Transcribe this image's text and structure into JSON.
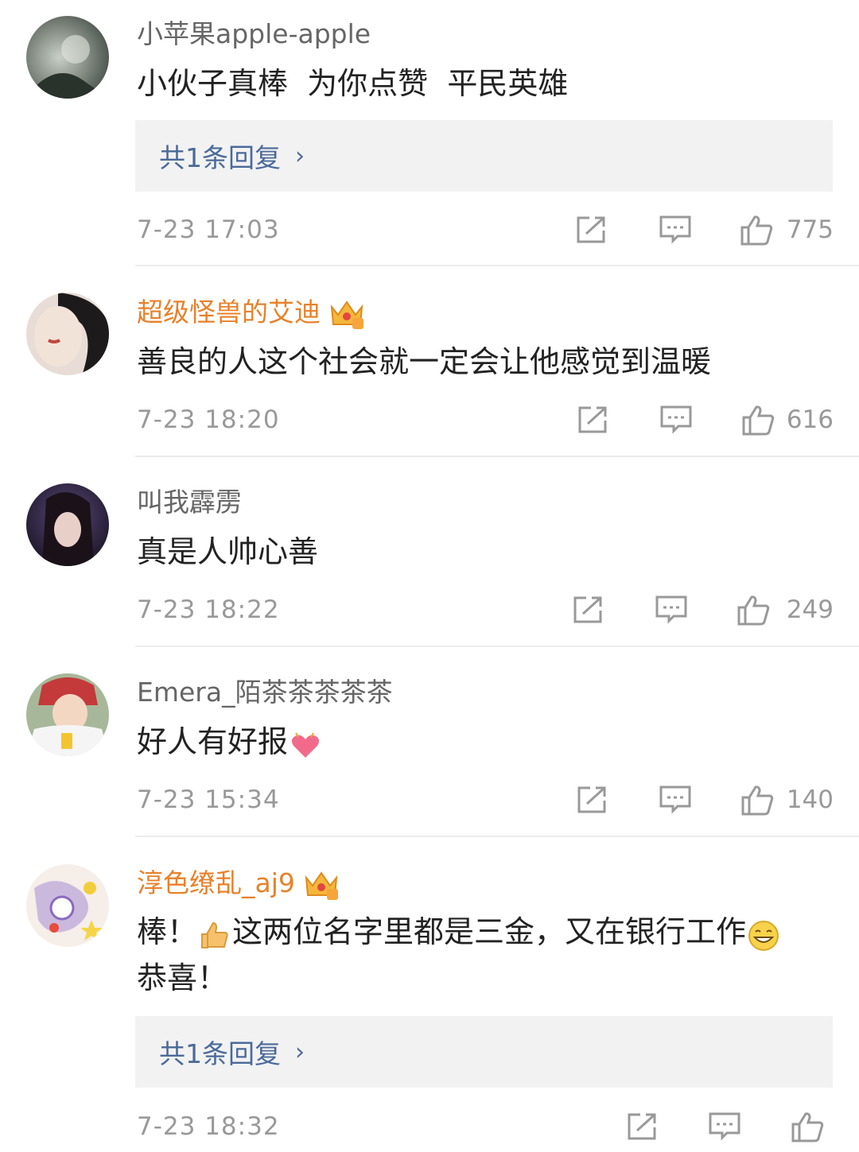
{
  "comments": [
    {
      "user": "小苹果apple-apple",
      "text": "小伙子真棒  为你点赞  平民英雄",
      "reply_label": "共1条回复",
      "time": "7-23 17:03",
      "likes": "775"
    },
    {
      "user": "超级怪兽的艾迪",
      "text": "善良的人这个社会就一定会让他感觉到温暖",
      "time": "7-23 18:20",
      "likes": "616"
    },
    {
      "user": "叫我霹雳",
      "text": "真是人帅心善",
      "time": "7-23 18:22",
      "likes": "249"
    },
    {
      "user": "Emera_陌茶茶茶茶茶",
      "text": "好人有好报",
      "time": "7-23 15:34",
      "likes": "140"
    },
    {
      "user": "淳色缭乱_aj9",
      "text_part1": "棒！",
      "text_part2": "这两位名字里都是三金，又在银行工作",
      "text_line2": "恭喜！",
      "reply_label": "共1条回复",
      "time": "7-23 18:32"
    }
  ],
  "icons": {
    "share": "share-icon",
    "comment": "comment-icon",
    "like": "thumbs-up-icon",
    "chevron": "›"
  },
  "colors": {
    "vip_name": "#e8812a",
    "link": "#4a6a9a",
    "meta": "#999999"
  }
}
